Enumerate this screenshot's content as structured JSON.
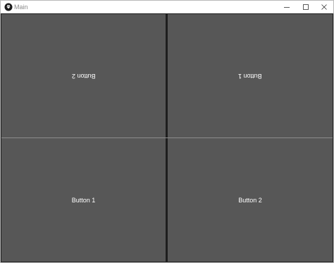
{
  "window": {
    "title": "Main"
  },
  "buttons": {
    "top_left": "Button 2",
    "top_right": "Button 1",
    "bottom_left": "Button 1",
    "bottom_right": "Button 2"
  },
  "colors": {
    "button_bg": "#575757",
    "button_text": "#ffffff",
    "separator": "#1e1e1e"
  }
}
